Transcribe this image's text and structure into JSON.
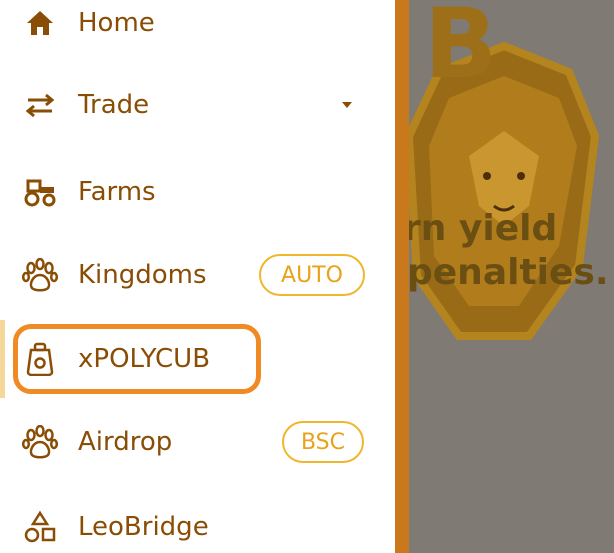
{
  "nav": {
    "items": [
      {
        "label": "Home",
        "icon": "home-icon"
      },
      {
        "label": "Trade",
        "icon": "swap-arrows-icon",
        "has_dropdown": true
      },
      {
        "label": "Farms",
        "icon": "tractor-icon"
      },
      {
        "label": "Kingdoms",
        "icon": "paw-icon",
        "badge": "AUTO"
      },
      {
        "label": "xPOLYCUB",
        "icon": "bag-icon",
        "highlighted": true
      },
      {
        "label": "Airdrop",
        "icon": "paw-icon",
        "badge": "BSC"
      },
      {
        "label": "LeoBridge",
        "icon": "shapes-icon"
      }
    ]
  },
  "background": {
    "logo_letter": "B",
    "text_line1": "rn yield",
    "text_line2": "penalties."
  },
  "colors": {
    "nav_text": "#8a4d06",
    "badge_border": "#f0b62d",
    "highlight_border": "#f08a24",
    "divider": "#c9781b",
    "overlay": "#7f7a73"
  }
}
